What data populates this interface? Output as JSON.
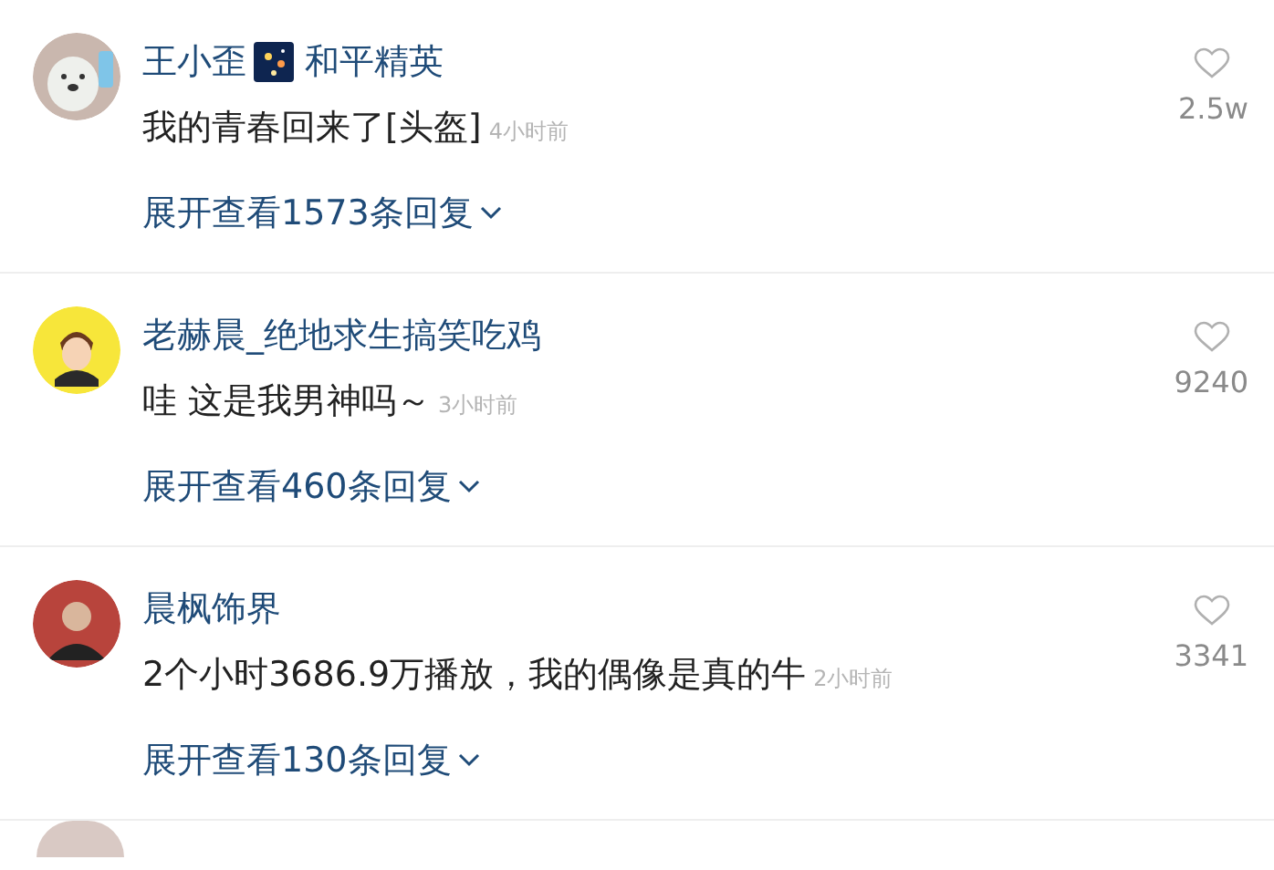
{
  "comments": [
    {
      "name": "王小歪",
      "game_tag": "和平精英",
      "kind": "bear",
      "text": "我的青春回来了[头盔]",
      "time": "4小时前",
      "likes": "2.5w",
      "replies": "展开查看1573条回复"
    },
    {
      "name": "老赫晨_绝地求生搞笑吃鸡",
      "kind": "cartoon",
      "text": "哇 这是我男神吗～",
      "time": "3小时前",
      "likes": "9240",
      "replies": "展开查看460条回复"
    },
    {
      "name": "晨枫饰界",
      "kind": "photo",
      "text": "2个小时3686.9万播放，我的偶像是真的牛",
      "time": "2小时前",
      "likes": "3341",
      "replies": "展开查看130条回复"
    }
  ]
}
